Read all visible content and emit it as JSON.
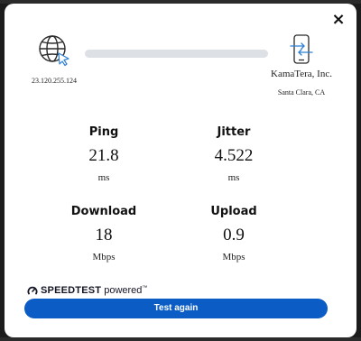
{
  "dialog": {
    "close_label": "×"
  },
  "client": {
    "icon": "globe-cursor-icon",
    "ip": "23.120.255.124"
  },
  "progress": {
    "fraction": 0,
    "track_color": "#dde0e4"
  },
  "server": {
    "icon": "phone-transfer-icon",
    "name": "KamaTera, Inc.",
    "location": "Santa Clara, CA"
  },
  "metrics": [
    {
      "label": "Ping",
      "value": "21.8",
      "unit": "ms"
    },
    {
      "label": "Jitter",
      "value": "4.522",
      "unit": "ms"
    },
    {
      "label": "Download",
      "value": "18",
      "unit": "Mbps"
    },
    {
      "label": "Upload",
      "value": "0.9",
      "unit": "Mbps"
    }
  ],
  "branding": {
    "icon": "speedtest-gauge-icon",
    "name": "SPEEDTEST",
    "suffix": "powered",
    "mark": "™"
  },
  "actions": {
    "test_again_label": "Test again",
    "button_color": "#0b5cc4"
  }
}
